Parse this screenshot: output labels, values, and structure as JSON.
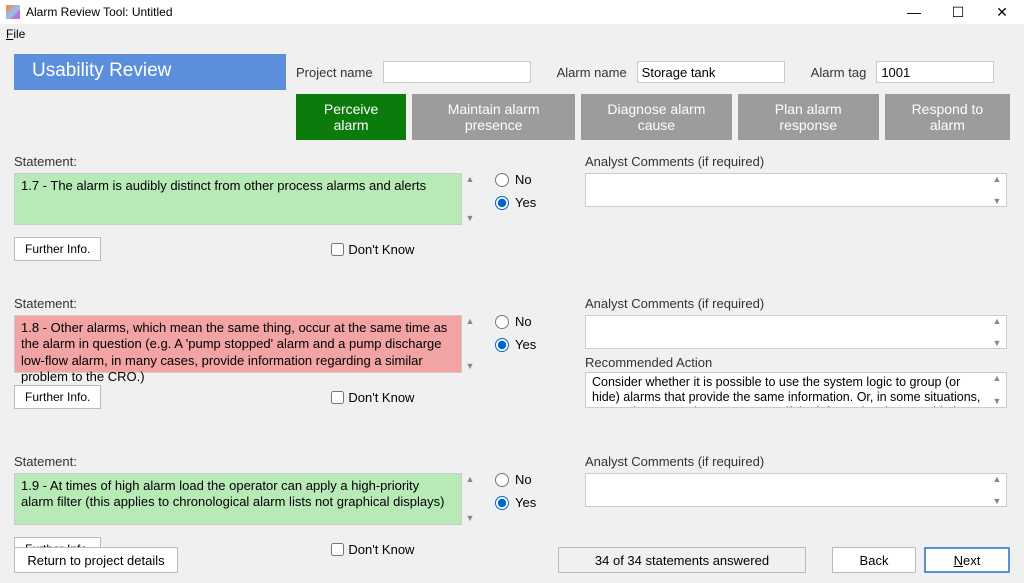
{
  "window": {
    "title": "Alarm Review Tool: Untitled",
    "menu_file": "File"
  },
  "banner": "Usability Review",
  "fields": {
    "project_label": "Project name",
    "project_value": "",
    "alarm_name_label": "Alarm name",
    "alarm_name_value": "Storage tank",
    "alarm_tag_label": "Alarm tag",
    "alarm_tag_value": "1001"
  },
  "tabs": {
    "perceive": "Perceive alarm",
    "maintain": "Maintain alarm presence",
    "diagnose": "Diagnose alarm cause",
    "plan": "Plan alarm response",
    "respond": "Respond to alarm"
  },
  "labels": {
    "statement": "Statement:",
    "further_info": "Further Info.",
    "dont_know": "Don't Know",
    "no": "No",
    "yes": "Yes",
    "analyst_comments": "Analyst Comments (if required)",
    "recommended_action": "Recommended Action"
  },
  "statements": {
    "s1": "1.7 - The alarm is audibly distinct from other process alarms and alerts",
    "s2": "1.8 - Other alarms, which mean the same thing, occur at the same time as the alarm in question (e.g. A 'pump stopped' alarm and a pump discharge low-flow alarm, in many cases, provide information regarding a similar problem to the CRO.)",
    "s3": "1.9 - At times of high alarm load the operator can apply a high-priority alarm filter (this applies to chronological alarm lists not graphical displays)"
  },
  "recommended": {
    "r2": "Consider whether it is possible to use the system logic to group (or hide) alarms that provide the same information.  Or, in some situations, some alarms may be unnecessary if the information they provide is duplicated by other alarms."
  },
  "footer": {
    "return": "Return to project details",
    "status": "34 of 34 statements answered",
    "back": "Back",
    "next": "Next"
  }
}
